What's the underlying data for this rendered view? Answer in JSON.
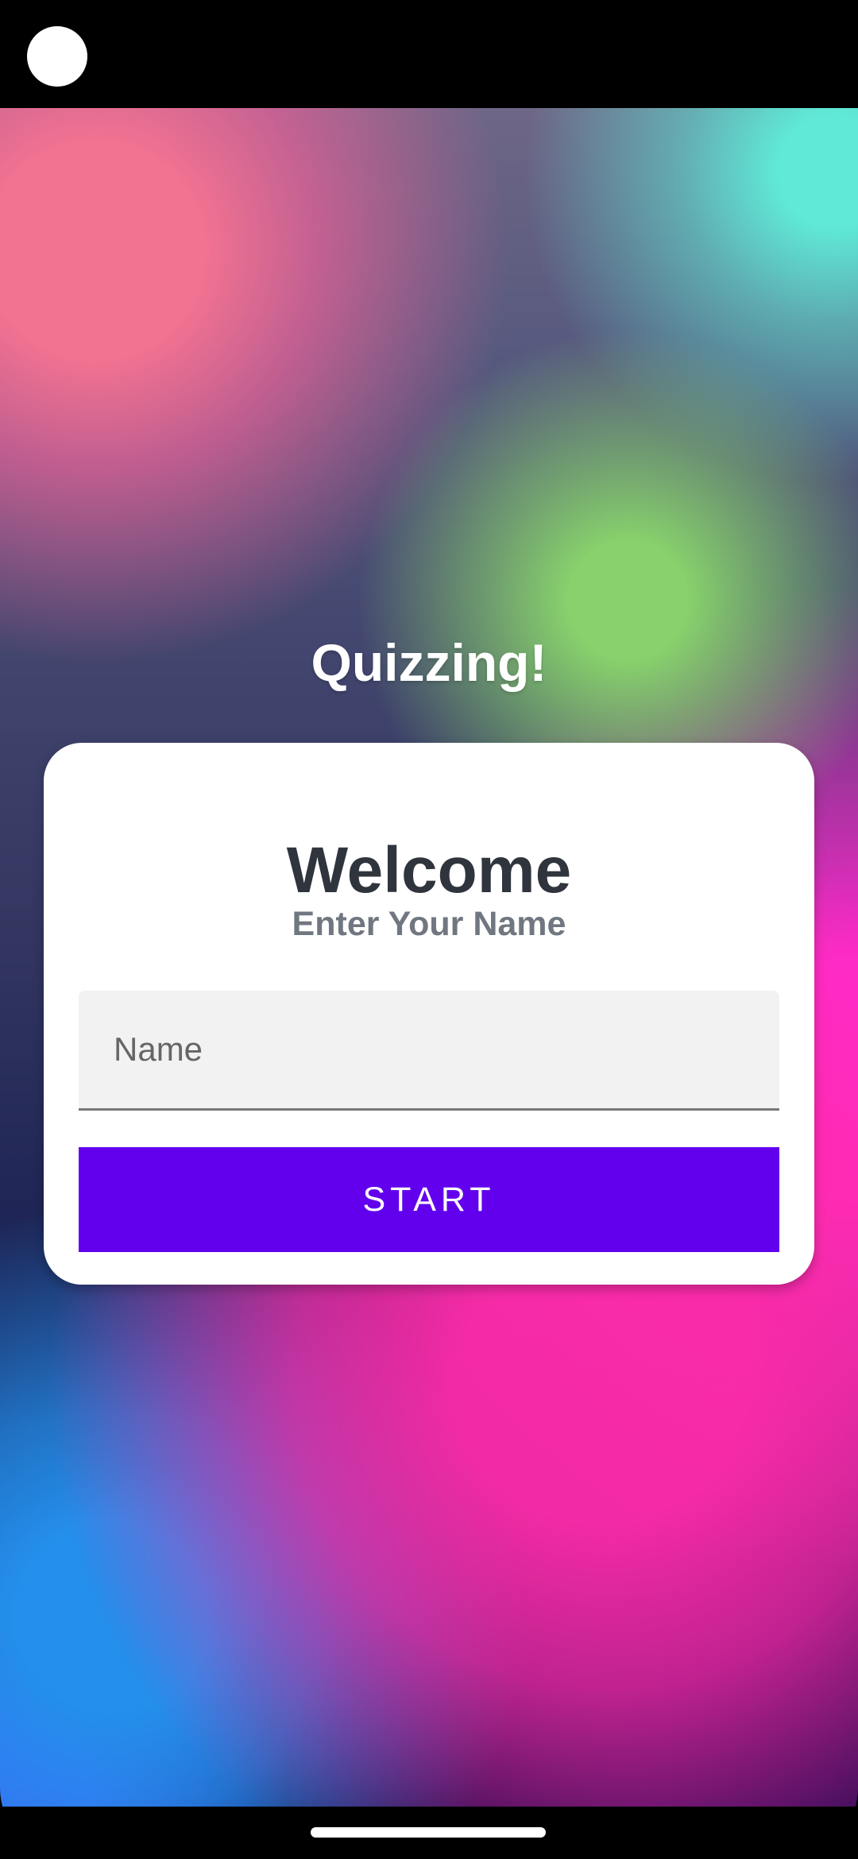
{
  "app": {
    "title": "Quizzing!"
  },
  "card": {
    "heading": "Welcome",
    "prompt": "Enter Your Name",
    "name_input": {
      "placeholder": "Name",
      "value": ""
    },
    "start_button_label": "START"
  },
  "colors": {
    "card_background": "#ffffff",
    "heading_text": "#2f343d",
    "prompt_text": "#707780",
    "input_background": "#f2f2f2",
    "button_background": "#6200ee",
    "button_text": "#ffffff",
    "system_bars": "#000000"
  },
  "icons": {
    "camera": "camera-cutout-icon",
    "home_indicator": "home-indicator-icon"
  }
}
